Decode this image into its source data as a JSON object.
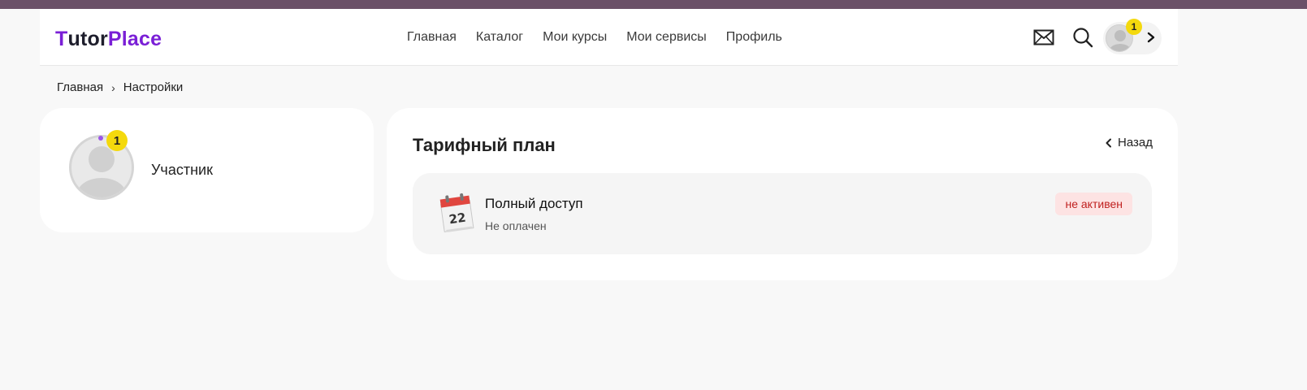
{
  "logo": {
    "t": "T",
    "utor": "utor",
    "place": "Place"
  },
  "nav": [
    "Главная",
    "Каталог",
    "Мои курсы",
    "Мои сервисы",
    "Профиль"
  ],
  "header": {
    "notification_count": "1"
  },
  "breadcrumb": {
    "home": "Главная",
    "separator": "›",
    "current": "Настройки"
  },
  "profile": {
    "role": "Участник",
    "badge_count": "1"
  },
  "plan": {
    "title": "Тарифный план",
    "back_label": "Назад",
    "item": {
      "calendar_day": "22",
      "name": "Полный доступ",
      "payment_status": "Не оплачен",
      "state": "не активен"
    }
  },
  "colors": {
    "accent": "#7a1fd6",
    "badge": "#f4d90d",
    "inactive_bg": "#fde3e3",
    "inactive_text": "#c0201f",
    "top_strip": "#6b5168"
  }
}
